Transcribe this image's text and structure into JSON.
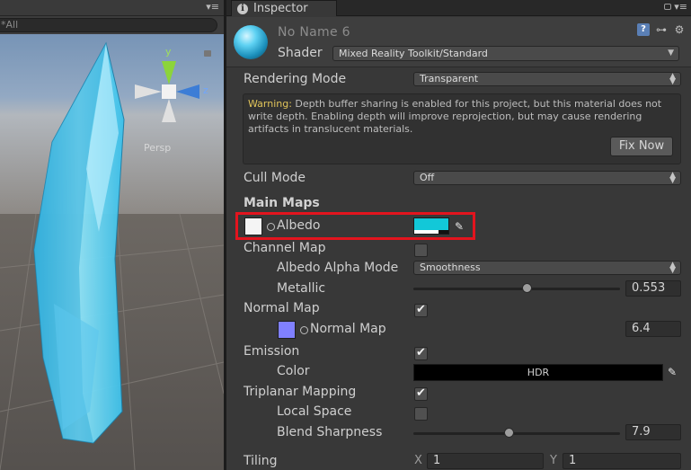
{
  "scene": {
    "search_placeholder": "All",
    "gizmo": {
      "y": "y",
      "z": "z",
      "persp": "Persp"
    },
    "menu_glyph": "▾≡"
  },
  "inspector": {
    "tab_label": "Inspector",
    "material_name": "No Name 6",
    "shader_label": "Shader",
    "shader_value": "Mixed Reality Toolkit/Standard",
    "rendering_mode_label": "Rendering Mode",
    "rendering_mode_value": "Transparent",
    "warning_strong": "Warning:",
    "warning_text": " Depth buffer sharing is enabled for this project, but this material does not write depth. Enabling depth will improve reprojection, but may cause rendering artifacts in translucent materials.",
    "fix_now_label": "Fix Now",
    "cull_mode_label": "Cull Mode",
    "cull_mode_value": "Off",
    "main_maps_title": "Main Maps",
    "albedo_label": "Albedo",
    "albedo_color": "#12c8d8",
    "channel_map_label": "Channel Map",
    "channel_map_checked": false,
    "albedo_alpha_mode_label": "Albedo Alpha Mode",
    "albedo_alpha_mode_value": "Smoothness",
    "metallic_label": "Metallic",
    "metallic_value": "0.553",
    "normal_map_toggle_label": "Normal Map",
    "normal_map_checked": true,
    "normal_map_slot_label": "Normal Map",
    "normal_map_scale": "6.4",
    "emission_label": "Emission",
    "emission_checked": true,
    "color_label": "Color",
    "hdr_label": "HDR",
    "triplanar_label": "Triplanar Mapping",
    "triplanar_checked": true,
    "local_space_label": "Local Space",
    "local_space_checked": false,
    "blend_sharpness_label": "Blend Sharpness",
    "blend_sharpness_value": "7.9",
    "tiling_label": "Tiling",
    "tiling_x_label": "X",
    "tiling_x_value": "1",
    "tiling_y_label": "Y",
    "tiling_y_value": "1"
  },
  "colors": {
    "highlight": "#e3141e",
    "warning": "#e0c45a",
    "albedo_swatch": "#12c8d8",
    "normal_swatch": "#8080ff"
  }
}
